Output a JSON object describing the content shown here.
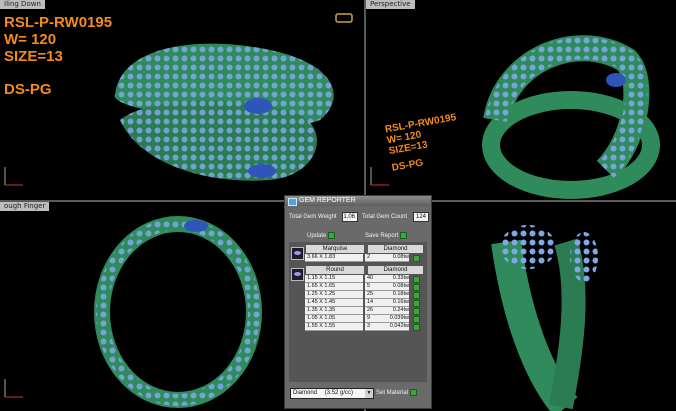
{
  "viewports": {
    "top_left": {
      "label": "Iling Down"
    },
    "top_right": {
      "label": "Perspective"
    },
    "bottom_left": {
      "label": "ough Finger"
    }
  },
  "ring_tag": {
    "code": "RSL-P-RW0195",
    "weight": "W= 120",
    "size": "SIZE=13",
    "finish": "DS-PG"
  },
  "gem_reporter": {
    "title": "GEM REPORTER",
    "total_weight_label": "Total Gem Weight",
    "total_weight_value": "1.06",
    "total_count_label": "Total Gem Count",
    "total_count_value": "124",
    "update_label": "Update",
    "save_report_label": "Save Report",
    "groups": [
      {
        "shape": "Marquise",
        "material": "Diamond",
        "rows": [
          {
            "size": "3.66 X 1.83",
            "count": "2",
            "weight": "0.08tw"
          }
        ]
      },
      {
        "shape": "Round",
        "material": "Diamond",
        "rows": [
          {
            "size": "1.15 X 1.15",
            "count": "40",
            "weight": "0.33tw"
          },
          {
            "size": "1.65 X 1.65",
            "count": "5",
            "weight": "0.08tw"
          },
          {
            "size": "1.25 X 1.25",
            "count": "25",
            "weight": "0.18tw"
          },
          {
            "size": "1.45 X 1.45",
            "count": "14",
            "weight": "0.16tw"
          },
          {
            "size": "1.35 X 1.35",
            "count": "26",
            "weight": "0.24tw"
          },
          {
            "size": "1.05 X 1.05",
            "count": "9",
            "weight": "0.039tw"
          },
          {
            "size": "1.55 X 1.55",
            "count": "3",
            "weight": "0.042tw"
          }
        ]
      }
    ],
    "material_select_value": "Diamond",
    "material_select_density": "(3.52 g/cc)",
    "set_material_label": "Set Material"
  },
  "colors": {
    "tag_orange": "#f28a1c",
    "metal_green": "#2f8a5c",
    "gem_blue": "#7fa8e8",
    "accent_green": "#3fa33f"
  },
  "icons": [
    "axis-gizmo-icon",
    "gem-reporter-icon",
    "marquise-gem-icon",
    "round-gem-icon",
    "dropdown-arrow-icon"
  ]
}
